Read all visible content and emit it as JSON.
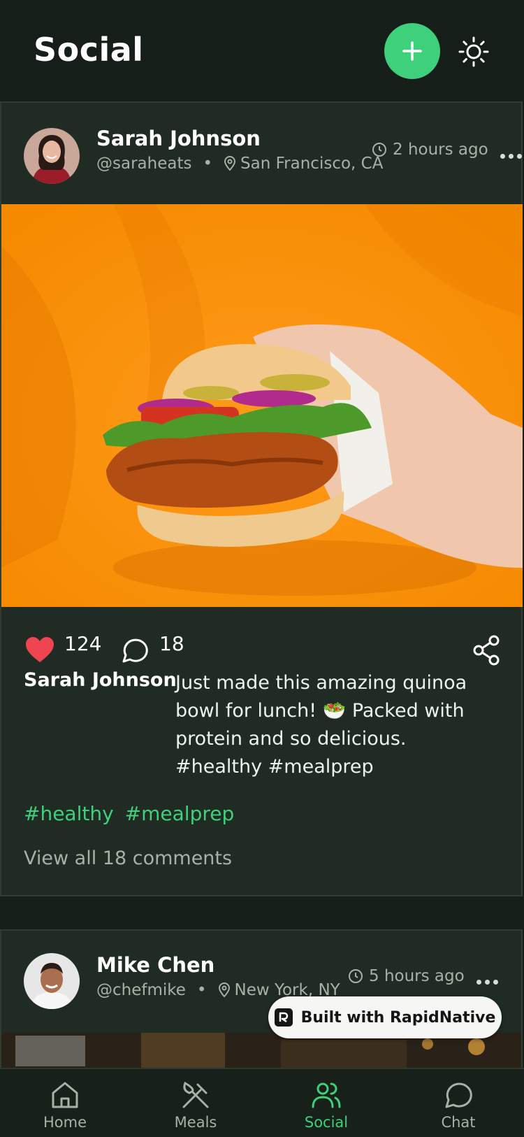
{
  "header": {
    "title": "Social",
    "add_icon": "plus-icon",
    "theme_icon": "sun-icon"
  },
  "posts": [
    {
      "author": "Sarah Johnson",
      "handle": "@saraheats",
      "location": "San Francisco, CA",
      "time": "2 hours ago",
      "likes": "124",
      "comments": "18",
      "caption_author": "Sarah Johnson",
      "caption": "Just made this amazing quinoa bowl for lunch! 🥗 Packed with protein and so delicious. #healthy #mealprep",
      "tags": [
        "#healthy",
        "#mealprep"
      ],
      "view_comments": "View all 18 comments"
    },
    {
      "author": "Mike Chen",
      "handle": "@chefmike",
      "location": "New York, NY",
      "time": "5 hours ago"
    }
  ],
  "badge": {
    "label": "Built with RapidNative"
  },
  "tabs": [
    {
      "label": "Home",
      "icon": "home-icon"
    },
    {
      "label": "Meals",
      "icon": "utensils-icon"
    },
    {
      "label": "Social",
      "icon": "users-icon"
    },
    {
      "label": "Chat",
      "icon": "chat-bubble-icon"
    }
  ],
  "colors": {
    "accent": "#3fd07b",
    "like": "#ef4452",
    "background": "#151e18",
    "card": "#1f2b23"
  }
}
